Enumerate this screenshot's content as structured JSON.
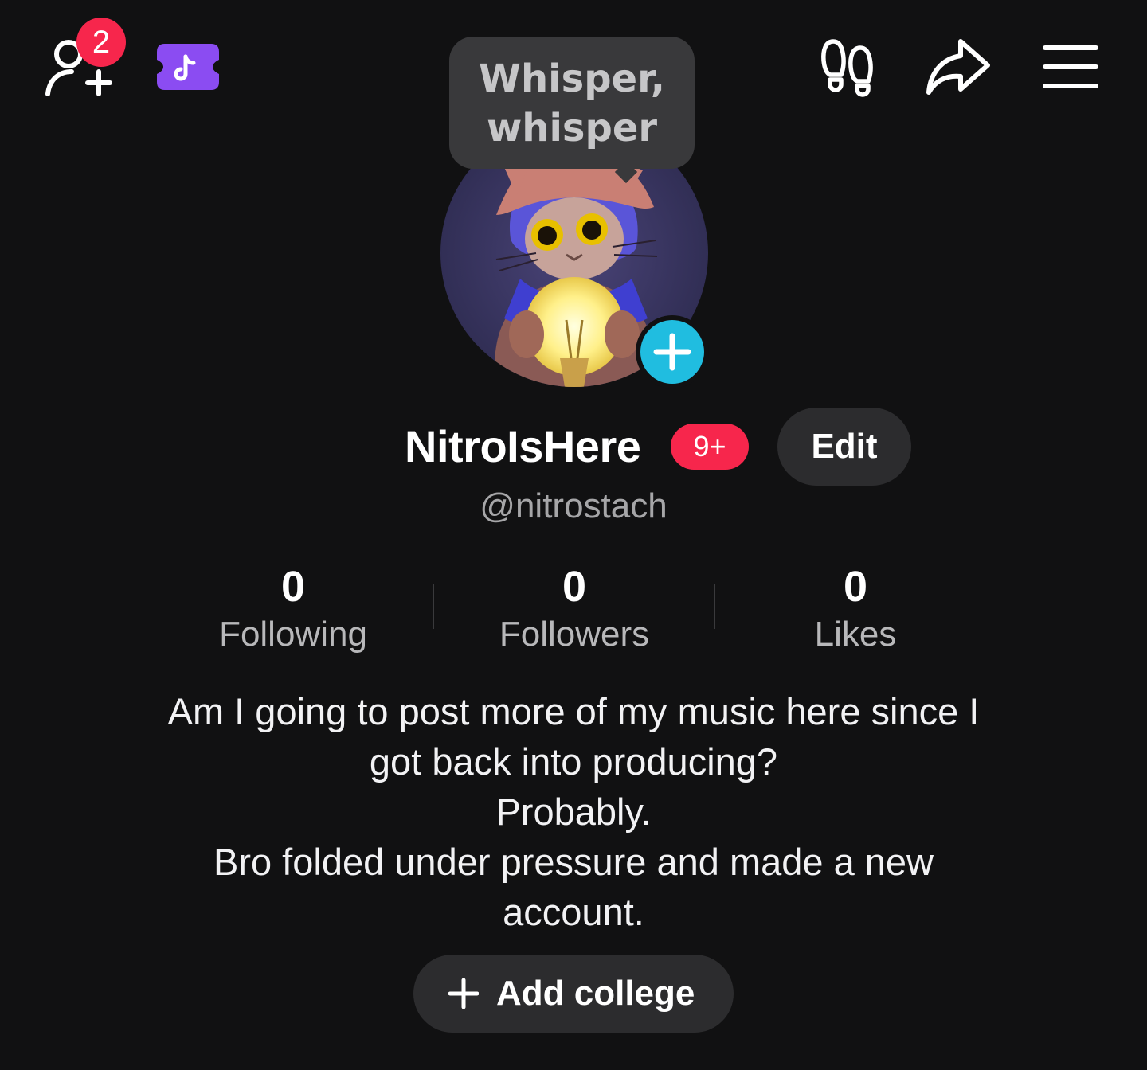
{
  "header": {
    "add_friends_badge": "2",
    "tooltip_text": "Whisper, whisper"
  },
  "icons": {
    "add_friends": "add-user-icon",
    "tiktok_ticket": "tiktok-ticket-icon",
    "profile_views": "footprints-icon",
    "share": "share-arrow-icon",
    "menu": "hamburger-menu-icon",
    "add_avatar": "plus-circle-icon",
    "add_college": "plus-icon"
  },
  "profile": {
    "display_name": "NitroIsHere",
    "name_badge": "9+",
    "edit_label": "Edit",
    "handle": "@nitrostach"
  },
  "stats": [
    {
      "value": "0",
      "label": "Following"
    },
    {
      "value": "0",
      "label": "Followers"
    },
    {
      "value": "0",
      "label": "Likes"
    }
  ],
  "bio": {
    "lines": [
      "Am I going to post more of my music here since I",
      "got back into producing?",
      "Probably.",
      "Bro folded under pressure and made a new",
      "account."
    ]
  },
  "actions": {
    "add_college_label": "Add college"
  },
  "colors": {
    "background": "#111112",
    "badge_red": "#f7264c",
    "accent_cyan": "#20bde0",
    "ticket_purple": "#8b4cf2",
    "button_gray": "#2c2c2e"
  }
}
